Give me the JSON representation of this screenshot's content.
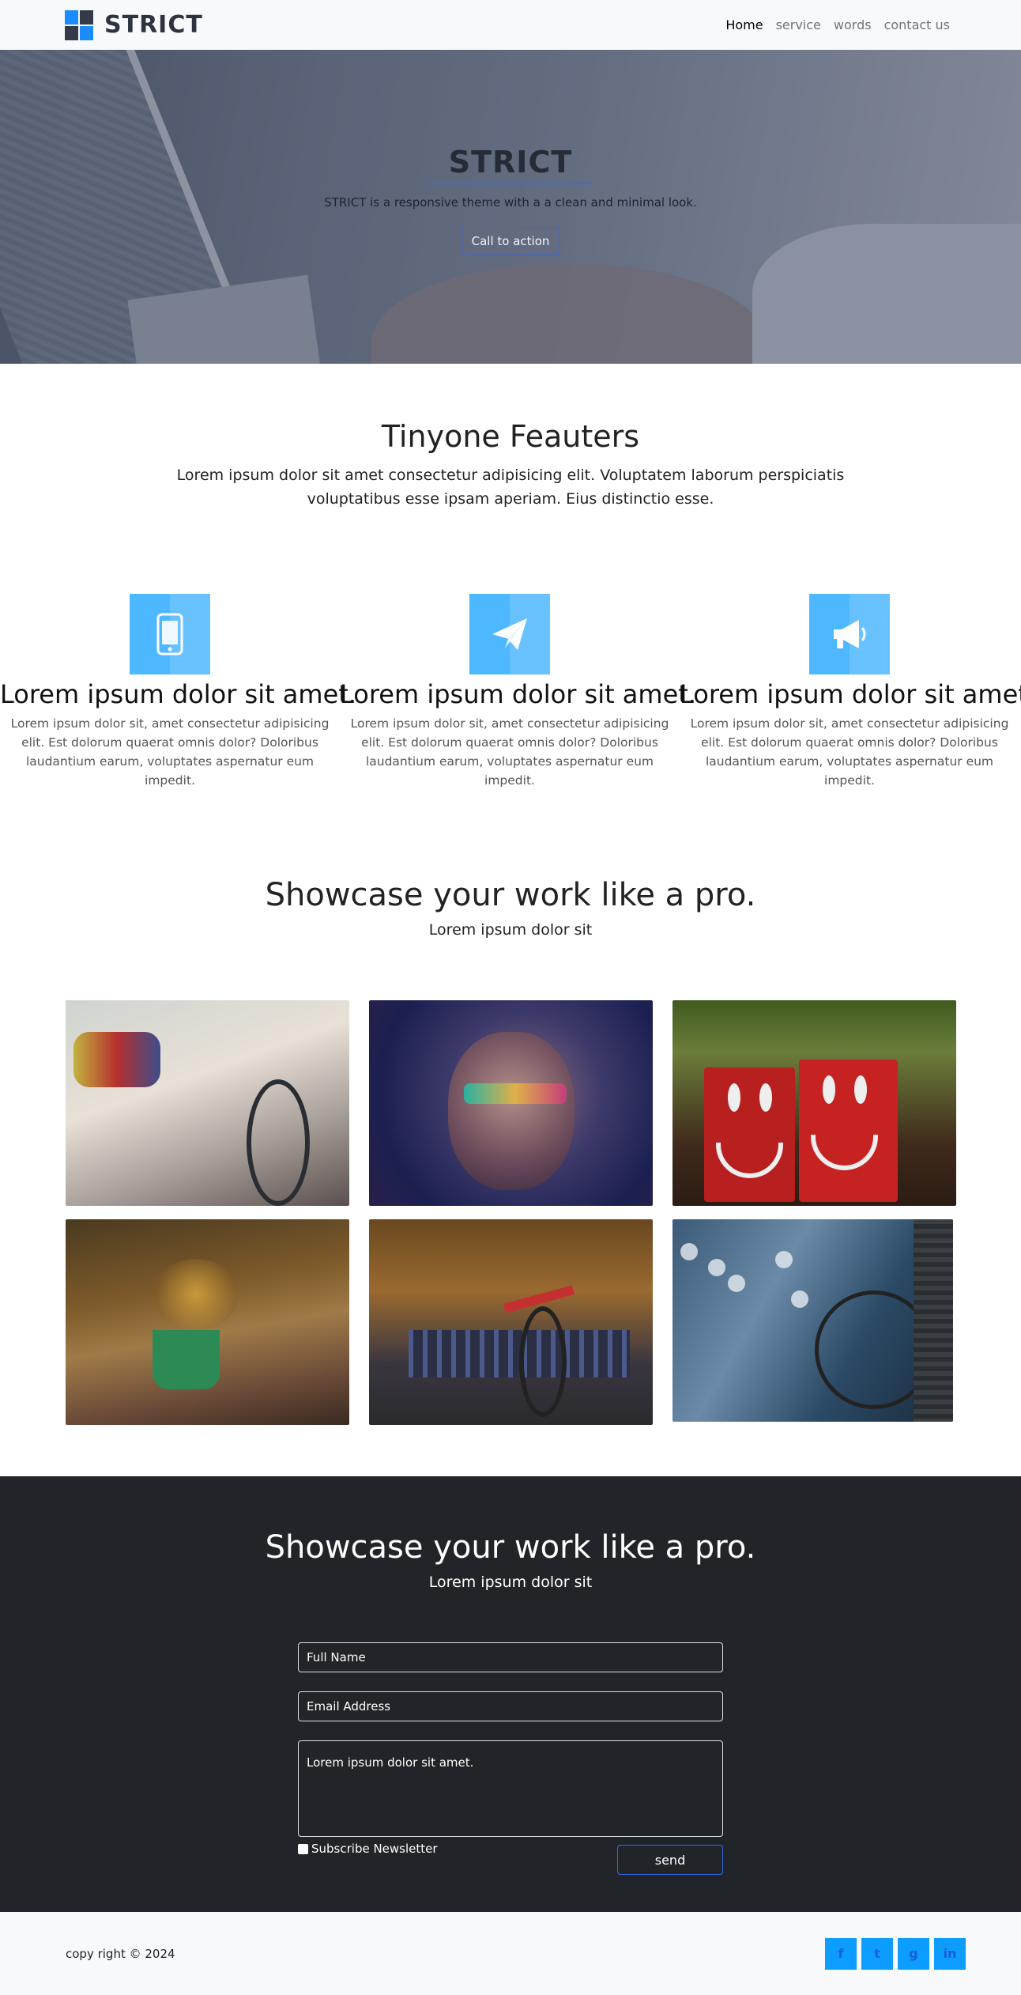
{
  "nav": {
    "brand": "STRICT",
    "links": [
      "Home",
      "service",
      "words",
      "contact us"
    ]
  },
  "hero": {
    "title": "STRICT",
    "subtitle": "STRICT is a responsive theme with a a clean and minimal look.",
    "cta": "Call to action"
  },
  "features": {
    "title": "Tinyone Feauters",
    "intro": "Lorem ipsum dolor sit amet consectetur adipisicing elit. Voluptatem laborum perspiciatis voluptatibus esse ipsam aperiam. Eius distinctio esse.",
    "items": [
      {
        "icon": "mobile-phone-icon",
        "title": "Lorem ipsum dolor sit amet.",
        "text": "Lorem ipsum dolor sit, amet consectetur adipisicing elit. Est dolorum quaerat omnis dolor? Doloribus laudantium earum, voluptates aspernatur eum impedit."
      },
      {
        "icon": "paper-plane-icon",
        "title": "Lorem ipsum dolor sit amet.",
        "text": "Lorem ipsum dolor sit, amet consectetur adipisicing elit. Est dolorum quaerat omnis dolor? Doloribus laudantium earum, voluptates aspernatur eum impedit."
      },
      {
        "icon": "megaphone-icon",
        "title": "Lorem ipsum dolor sit amet.",
        "text": "Lorem ipsum dolor sit, amet consectetur adipisicing elit. Est dolorum quaerat omnis dolor? Doloribus laudantium earum, voluptates aspernatur eum impedit."
      }
    ],
    "accent": "#4db8ff"
  },
  "showcase": {
    "title": "Showcase your work like a pro.",
    "subtitle": "Lorem ipsum dolor sit"
  },
  "contact": {
    "title": "Showcase your work like a pro.",
    "subtitle": "Lorem ipsum dolor sit",
    "name_placeholder": "Full Name",
    "email_placeholder": "Email Address",
    "message_value": "Lorem ipsum dolor sit amet.",
    "subscribe_label": "Subscribe Newsletter",
    "send_label": "send"
  },
  "footer": {
    "copyright": "copy right © 2024",
    "social": [
      {
        "icon": "facebook-icon",
        "glyph": "f"
      },
      {
        "icon": "twitter-icon",
        "glyph": "t"
      },
      {
        "icon": "google-plus-icon",
        "glyph": "g"
      },
      {
        "icon": "linkedin-icon",
        "glyph": "in"
      }
    ]
  }
}
